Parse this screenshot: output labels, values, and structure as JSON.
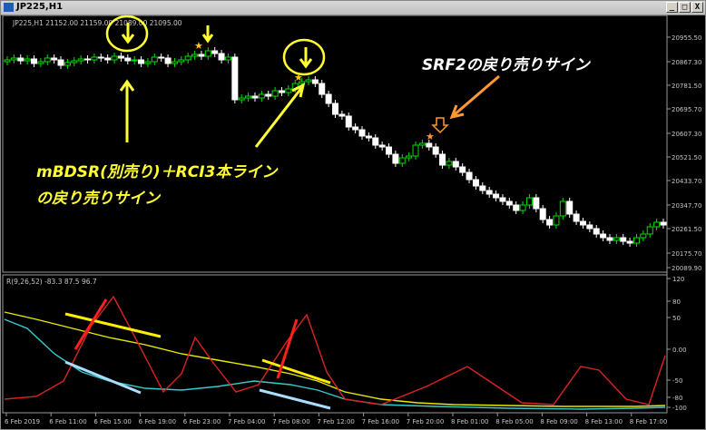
{
  "window": {
    "title": "JP225,H1",
    "buttons": {
      "minimize": "_",
      "restore": "□",
      "close": "X"
    }
  },
  "main_chart": {
    "info": "JP225,H1  21152.00 21159.00 21089.00 21095.00",
    "price_labels": [
      "20955.50",
      "20867.30",
      "20781.50",
      "20695.70",
      "20607.30",
      "20521.50",
      "20433.70",
      "20347.70",
      "20261.50",
      "20175.70",
      "20089.90"
    ],
    "annotation_left_line1": "mBDSR(別売り)＋RCI3本ライン",
    "annotation_left_line2": "の戻り売りサイン",
    "annotation_right": "SRF2の戻り売りサイン"
  },
  "sub_chart": {
    "info": "R(9,26,52) -83.3 87.5 96.7",
    "levels": [
      "120",
      "80",
      "50",
      "0.00",
      "-50",
      "-80",
      "-100"
    ]
  },
  "time_axis": [
    "6 Feb 2019",
    "6 Feb 11:00",
    "6 Feb 15:00",
    "6 Feb 19:00",
    "6 Feb 23:00",
    "7 Feb 04:00",
    "7 Feb 08:00",
    "7 Feb 12:00",
    "7 Feb 16:00",
    "7 Feb 20:00",
    "8 Feb 01:00",
    "8 Feb 05:00",
    "8 Feb 09:00",
    "8 Feb 13:00",
    "8 Feb 17:00"
  ],
  "colors": {
    "bull": "#00e000",
    "bear": "#ffffff",
    "annotation_yellow": "#ffff33",
    "annotation_orange": "#ff9933",
    "rci_red": "#dd2222",
    "rci_yellow": "#e8e800",
    "rci_cyan": "#33cccc"
  }
}
